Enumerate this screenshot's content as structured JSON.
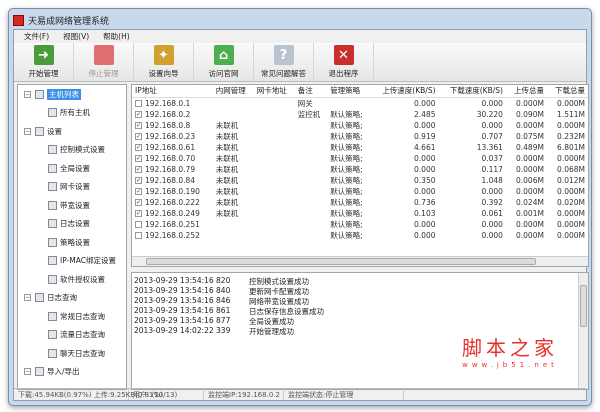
{
  "title": "天易成网络管理系统",
  "menu": [
    "文件(F)",
    "视图(V)",
    "帮助(H)"
  ],
  "toolbar": [
    {
      "label": "开始管理",
      "icon": "start-icon",
      "color": "#4a9c3a",
      "glyph": "➜",
      "disabled": false
    },
    {
      "label": "停止管理",
      "icon": "stop-icon",
      "color": "#e07070",
      "glyph": "",
      "disabled": true
    },
    {
      "label": "设置向导",
      "icon": "wand-icon",
      "color": "#d0a030",
      "glyph": "✦",
      "disabled": false
    },
    {
      "label": "访问官网",
      "icon": "home-icon",
      "color": "#4fae4f",
      "glyph": "⌂",
      "disabled": false
    },
    {
      "label": "常见问题解答",
      "icon": "help-icon",
      "color": "#b8c4d0",
      "glyph": "?",
      "disabled": false
    },
    {
      "label": "退出程序",
      "icon": "exit-icon",
      "color": "#c83030",
      "glyph": "✕",
      "disabled": false
    }
  ],
  "tree": [
    {
      "label": "主机列表",
      "level": 0,
      "selected": true,
      "icon": "computer-icon"
    },
    {
      "label": "所有主机",
      "level": 1,
      "icon": "hosts-icon"
    },
    {
      "label": "设置",
      "level": 0,
      "icon": "wrench-icon"
    },
    {
      "label": "控制模式设置",
      "level": 1,
      "icon": "control-icon"
    },
    {
      "label": "全局设置",
      "level": 1,
      "icon": "gear-icon"
    },
    {
      "label": "网卡设置",
      "level": 1,
      "icon": "nic-icon"
    },
    {
      "label": "带宽设置",
      "level": 1,
      "icon": "bandwidth-icon"
    },
    {
      "label": "日志设置",
      "level": 1,
      "icon": "log-icon"
    },
    {
      "label": "策略设置",
      "level": 1,
      "icon": "policy-icon"
    },
    {
      "label": "IP-MAC绑定设置",
      "level": 1,
      "icon": "ipmac-icon"
    },
    {
      "label": "软件授权设置",
      "level": 1,
      "icon": "license-icon"
    },
    {
      "label": "日志查询",
      "level": 0,
      "icon": "logquery-icon"
    },
    {
      "label": "常规日志查询",
      "level": 1,
      "icon": "normal-log-icon"
    },
    {
      "label": "流量日志查询",
      "level": 1,
      "icon": "traffic-log-icon"
    },
    {
      "label": "聊天日志查询",
      "level": 1,
      "icon": "chat-log-icon"
    },
    {
      "label": "导入/导出",
      "level": 0,
      "icon": "import-export-icon"
    }
  ],
  "columns": [
    "IP地址",
    "内网管理",
    "网卡地址",
    "备注",
    "管理策略",
    "上传速度(KB/S)",
    "下载速度(KB/S)",
    "上传总量",
    "下载总量"
  ],
  "rows": [
    {
      "checked": false,
      "c": [
        "192.168.0.1",
        "",
        "",
        "网关",
        "",
        "0.000",
        "0.000",
        "0.000M",
        "0.000M"
      ]
    },
    {
      "checked": true,
      "c": [
        "192.168.0.2",
        "",
        "",
        "监控机",
        "默认策略;",
        "2.485",
        "30.220",
        "0.090M",
        "1.511M"
      ]
    },
    {
      "checked": true,
      "c": [
        "192.168.0.8",
        "未联机",
        "",
        "",
        "默认策略;",
        "0.000",
        "0.000",
        "0.000M",
        "0.000M"
      ]
    },
    {
      "checked": true,
      "c": [
        "192.168.0.23",
        "未联机",
        "",
        "",
        "默认策略;",
        "0.919",
        "0.707",
        "0.075M",
        "0.232M"
      ]
    },
    {
      "checked": true,
      "c": [
        "192.168.0.61",
        "未联机",
        "",
        "",
        "默认策略;",
        "4.661",
        "13.361",
        "0.489M",
        "6.801M"
      ]
    },
    {
      "checked": true,
      "c": [
        "192.168.0.70",
        "未联机",
        "",
        "",
        "默认策略;",
        "0.000",
        "0.037",
        "0.000M",
        "0.000M"
      ]
    },
    {
      "checked": true,
      "c": [
        "192.168.0.79",
        "未联机",
        "",
        "",
        "默认策略;",
        "0.000",
        "0.117",
        "0.000M",
        "0.068M"
      ]
    },
    {
      "checked": true,
      "c": [
        "192.168.0.84",
        "未联机",
        "",
        "",
        "默认策略;",
        "0.350",
        "1.048",
        "0.006M",
        "0.012M"
      ]
    },
    {
      "checked": true,
      "c": [
        "192.168.0.190",
        "未联机",
        "",
        "",
        "默认策略;",
        "0.000",
        "0.000",
        "0.000M",
        "0.000M"
      ]
    },
    {
      "checked": true,
      "c": [
        "192.168.0.222",
        "未联机",
        "",
        "",
        "默认策略;",
        "0.736",
        "0.392",
        "0.024M",
        "0.020M"
      ]
    },
    {
      "checked": true,
      "c": [
        "192.168.0.249",
        "未联机",
        "",
        "",
        "默认策略;",
        "0.103",
        "0.061",
        "0.001M",
        "0.000M"
      ]
    },
    {
      "checked": false,
      "c": [
        "192.168.0.251",
        "",
        "",
        "",
        "默认策略;",
        "0.000",
        "0.000",
        "0.000M",
        "0.000M"
      ]
    },
    {
      "checked": false,
      "c": [
        "192.168.0.252",
        "",
        "",
        "",
        "默认策略;",
        "0.000",
        "0.000",
        "0.000M",
        "0.000M"
      ]
    }
  ],
  "log": [
    {
      "time": "2013-09-29 13:54:16 820",
      "msg": "控制模式设置成功"
    },
    {
      "time": "2013-09-29 13:54:16 840",
      "msg": "更新网卡配置成功"
    },
    {
      "time": "2013-09-29 13:54:16 846",
      "msg": "网络带宽设置成功"
    },
    {
      "time": "2013-09-29 13:54:16 861",
      "msg": "日志保存信息设置成功"
    },
    {
      "time": "2013-09-29 13:54:16 877",
      "msg": "全局设置成功"
    },
    {
      "time": "2013-09-29 14:02:22 339",
      "msg": "开始管理成功"
    }
  ],
  "watermark": {
    "main": "脚本之家",
    "url": "www.jb51.net"
  },
  "status": [
    "下载:45.94KB(0.97%) 上传:9.25KB(0.81%)",
    "用户: (10/13)",
    "监控端IP:192.168.0.2",
    "监控端状态:停止管理"
  ]
}
